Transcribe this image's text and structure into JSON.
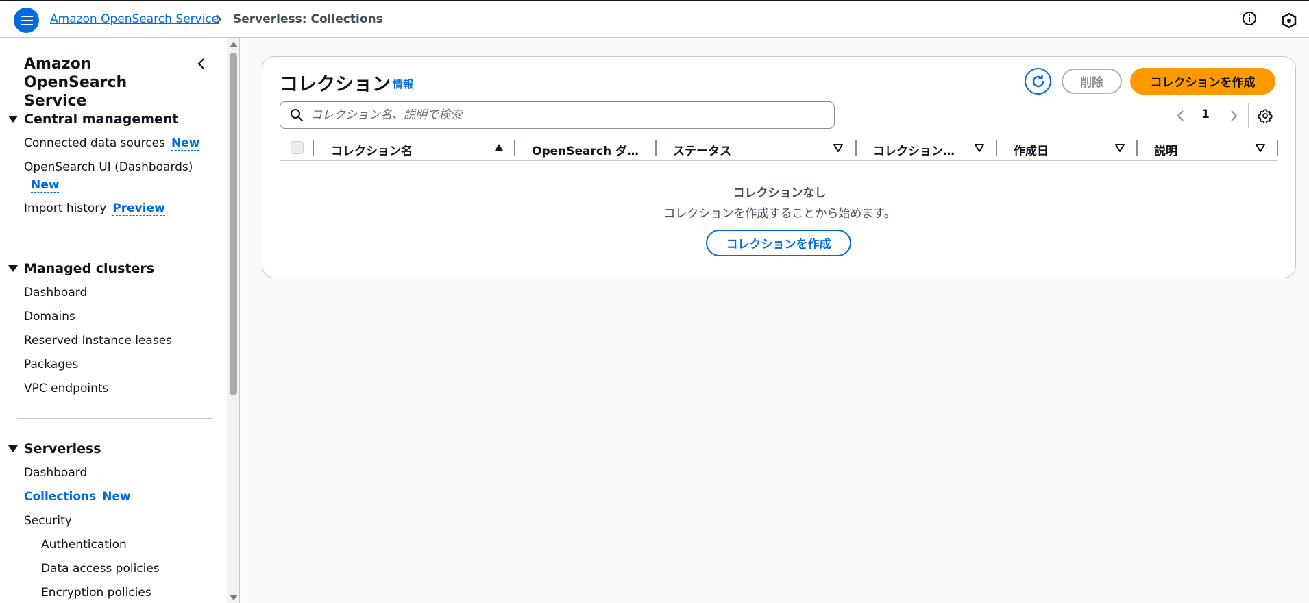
{
  "topbar": {
    "breadcrumb_root": "Amazon OpenSearch Service",
    "breadcrumb_current": "Serverless: Collections",
    "icons": [
      "menu-icon",
      "chevron-right-icon",
      "info-icon",
      "hexagon-icon"
    ]
  },
  "sidebar": {
    "title": "Amazon OpenSearch Service",
    "central": {
      "heading": "Central management",
      "connected": "Connected data sources",
      "connected_badge": "New",
      "ui_dashboards": "OpenSearch UI (Dashboards)",
      "ui_badge": "New",
      "import_history": "Import history",
      "import_badge": "Preview"
    },
    "managed": {
      "heading": "Managed clusters",
      "items": [
        "Dashboard",
        "Domains",
        "Reserved Instance leases",
        "Packages",
        "VPC endpoints"
      ]
    },
    "serverless": {
      "heading": "Serverless",
      "dashboard": "Dashboard",
      "collections": "Collections",
      "collections_badge": "New",
      "security": "Security",
      "security_items": [
        "Authentication",
        "Data access policies",
        "Encryption policies"
      ]
    }
  },
  "main": {
    "title": "コレクション",
    "info": "情報",
    "delete_label": "削除",
    "create_label": "コレクションを作成",
    "search_placeholder": "コレクション名、説明で検索",
    "page": "1",
    "columns": [
      "コレクション名",
      "OpenSearch ダ…",
      "ステータス",
      "コレクション…",
      "作成日",
      "説明"
    ],
    "empty_title": "コレクションなし",
    "empty_desc": "コレクションを作成することから始めます。",
    "empty_create_label": "コレクションを作成"
  },
  "colors": {
    "accent": "#006ce0",
    "primary_button": "#ff9900",
    "border": "#c6c6cd"
  }
}
